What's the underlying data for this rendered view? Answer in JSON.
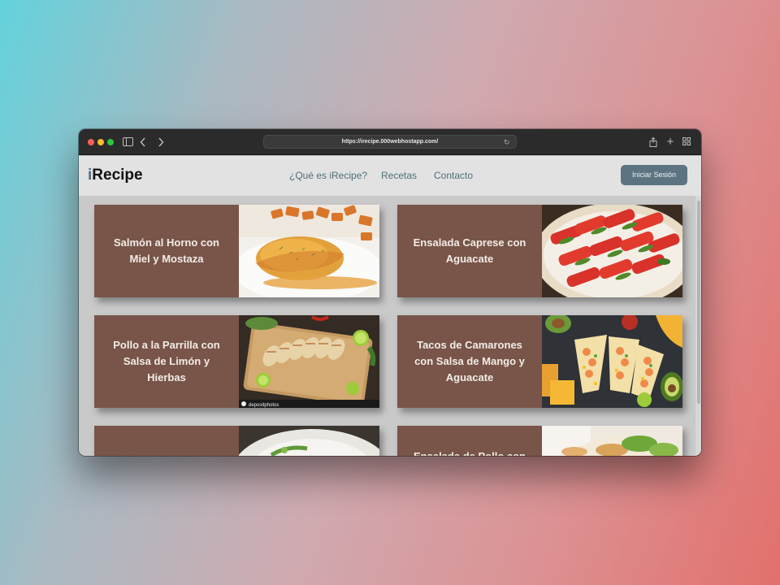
{
  "browser": {
    "url": "https://irecipe.000webhostapp.com/"
  },
  "navbar": {
    "logo_prefix": "i",
    "logo_rest": "Recipe",
    "links": [
      "¿Qué es iRecipe?",
      "Recetas",
      "Contacto"
    ],
    "login_label": "Iniciar Sesión"
  },
  "recipes": [
    {
      "title": "Salmón al Horno con Miel y Mostaza"
    },
    {
      "title": "Ensalada Caprese con Aguacate"
    },
    {
      "title": "Pollo a la Parrilla con Salsa de Limón y Hierbas"
    },
    {
      "title": "Tacos de Camarones con Salsa de Mango y Aguacate"
    },
    {
      "title": ""
    },
    {
      "title": "Ensalada de Pollo con"
    }
  ],
  "image_watermark": {
    "brand": "depositphotos"
  }
}
